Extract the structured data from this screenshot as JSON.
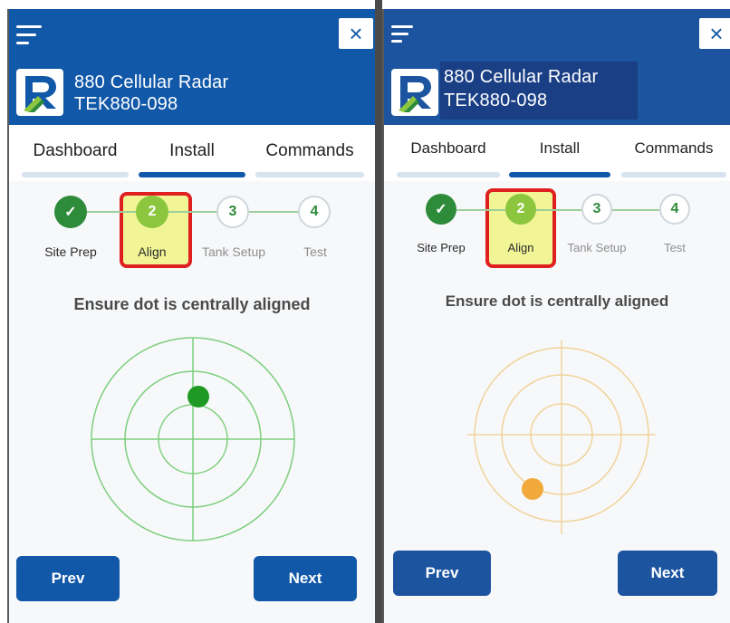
{
  "app": {
    "device_name": "880 Cellular Radar",
    "device_id": "TEK880-098",
    "close_symbol": "×"
  },
  "tabs": [
    {
      "label": "Dashboard"
    },
    {
      "label": "Install",
      "active": true
    },
    {
      "label": "Commands"
    }
  ],
  "steps": [
    {
      "number": "✓",
      "label": "Site Prep",
      "state": "done"
    },
    {
      "number": "2",
      "label": "Align",
      "state": "current"
    },
    {
      "number": "3",
      "label": "Tank Setup",
      "state": "todo"
    },
    {
      "number": "4",
      "label": "Test",
      "state": "todo"
    }
  ],
  "instruction": "Ensure dot is centrally aligned",
  "buttons": {
    "prev": "Prev",
    "next": "Next"
  },
  "panels": {
    "left": {
      "dot_status": "aligned",
      "dot_color": "#1e9a24",
      "radar_color": "#7ccf7c"
    },
    "right": {
      "dot_status": "misaligned",
      "dot_color": "#f0a93a",
      "radar_color": "#f0d49a"
    }
  },
  "colors": {
    "brand_blue": "#1258a8",
    "step_done": "#2e8b3a",
    "step_current": "#8cc63f",
    "highlight_border": "#e02020",
    "highlight_fill": "#f1f596"
  },
  "icons": [
    "menu-icon",
    "close-icon",
    "logo-icon",
    "check-icon"
  ]
}
